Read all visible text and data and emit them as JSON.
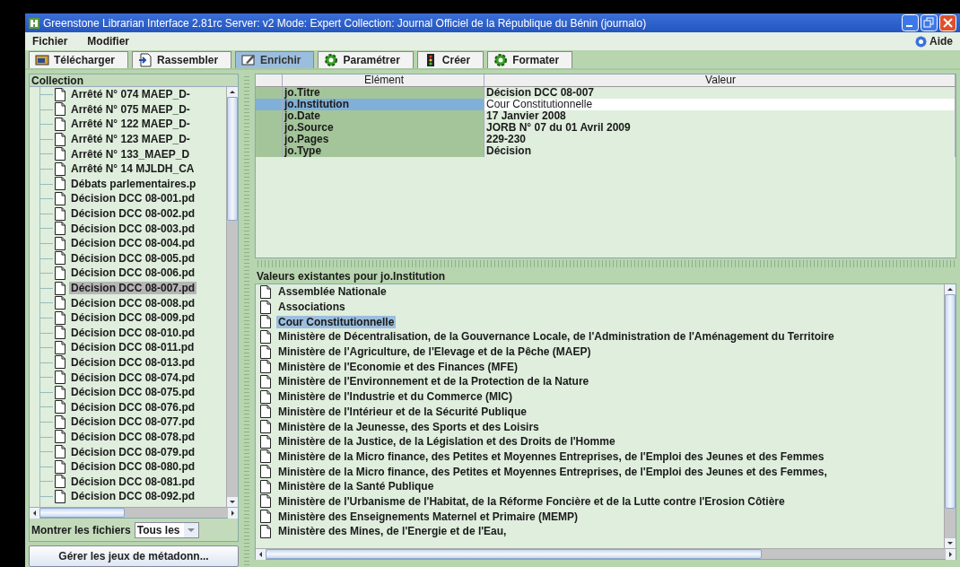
{
  "window": {
    "title": "Greenstone Librarian Interface 2.81rc  Server: v2  Mode: Expert  Collection: Journal Officiel de la République du Bénin (journalo)"
  },
  "menu": {
    "items": [
      "Fichier",
      "Modifier"
    ],
    "help": "Aide"
  },
  "tabs": [
    {
      "label": "Télécharger",
      "selected": false
    },
    {
      "label": "Rassembler",
      "selected": false
    },
    {
      "label": "Enrichir",
      "selected": true
    },
    {
      "label": "Paramétrer",
      "selected": false
    },
    {
      "label": "Créer",
      "selected": false
    },
    {
      "label": "Formater",
      "selected": false
    }
  ],
  "collection": {
    "title": "Collection",
    "items": [
      {
        "label": "Arrêté N° 074 MAEP_D-",
        "selected": false
      },
      {
        "label": "Arrêté N° 075 MAEP_D-",
        "selected": false
      },
      {
        "label": "Arrêté N° 122 MAEP_D-",
        "selected": false
      },
      {
        "label": "Arrêté N° 123 MAEP_D-",
        "selected": false
      },
      {
        "label": "Arrêté N° 133_MAEP_D",
        "selected": false
      },
      {
        "label": "Arrêté N° 14 MJLDH_CA",
        "selected": false
      },
      {
        "label": "Débats parlementaires.p",
        "selected": false
      },
      {
        "label": "Décision DCC 08-001.pd",
        "selected": false
      },
      {
        "label": "Décision DCC 08-002.pd",
        "selected": false
      },
      {
        "label": "Décision DCC 08-003.pd",
        "selected": false
      },
      {
        "label": "Décision DCC 08-004.pd",
        "selected": false
      },
      {
        "label": "Décision DCC 08-005.pd",
        "selected": false
      },
      {
        "label": "Décision DCC 08-006.pd",
        "selected": false
      },
      {
        "label": "Décision DCC 08-007.pd",
        "selected": true
      },
      {
        "label": "Décision DCC 08-008.pd",
        "selected": false
      },
      {
        "label": "Décision DCC 08-009.pd",
        "selected": false
      },
      {
        "label": "Décision DCC 08-010.pd",
        "selected": false
      },
      {
        "label": "Décision DCC 08-011.pd",
        "selected": false
      },
      {
        "label": "Décision DCC 08-013.pd",
        "selected": false
      },
      {
        "label": "Décision DCC 08-074.pd",
        "selected": false
      },
      {
        "label": "Décision DCC 08-075.pd",
        "selected": false
      },
      {
        "label": "Décision DCC 08-076.pd",
        "selected": false
      },
      {
        "label": "Décision DCC 08-077.pd",
        "selected": false
      },
      {
        "label": "Décision DCC 08-078.pd",
        "selected": false
      },
      {
        "label": "Décision DCC 08-079.pd",
        "selected": false
      },
      {
        "label": "Décision DCC 08-080.pd",
        "selected": false
      },
      {
        "label": "Décision DCC 08-081.pd",
        "selected": false
      },
      {
        "label": "Décision DCC 08-092.pd",
        "selected": false
      }
    ],
    "filter_label": "Montrer les fichiers",
    "filter_value": "Tous les",
    "manage_button": "Gérer les jeux de métadonn..."
  },
  "metadata": {
    "columns": [
      "Elément",
      "Valeur"
    ],
    "rows": [
      {
        "element": "jo.Titre",
        "value": "Décision DCC 08-007",
        "selected": false
      },
      {
        "element": "jo.Institution",
        "value": "Cour Constitutionnelle",
        "selected": true
      },
      {
        "element": "jo.Date",
        "value": "17 Janvier 2008",
        "selected": false
      },
      {
        "element": "jo.Source",
        "value": "JORB N° 07 du 01 Avril 2009",
        "selected": false
      },
      {
        "element": "jo.Pages",
        "value": "229-230",
        "selected": false
      },
      {
        "element": "jo.Type",
        "value": "Décision",
        "selected": false
      }
    ]
  },
  "existing_values": {
    "title": "Valeurs existantes pour jo.Institution",
    "items": [
      {
        "label": "Assemblée Nationale",
        "selected": false
      },
      {
        "label": "Associations",
        "selected": false
      },
      {
        "label": "Cour Constitutionnelle",
        "selected": true
      },
      {
        "label": "Ministère de Décentralisation, de la Gouvernance Locale, de l'Administration de l'Aménagement du Territoire",
        "selected": false
      },
      {
        "label": "Ministère de l'Agriculture, de l'Elevage et de la Pêche (MAEP)",
        "selected": false
      },
      {
        "label": "Ministère de l'Economie et des Finances (MFE)",
        "selected": false
      },
      {
        "label": "Ministère de l'Environnement et de la Protection de la Nature",
        "selected": false
      },
      {
        "label": "Ministère de l'Industrie et du Commerce (MIC)",
        "selected": false
      },
      {
        "label": "Ministère de l'Intérieur et de la Sécurité Publique",
        "selected": false
      },
      {
        "label": "Ministère de la Jeunesse, des Sports et des Loisirs",
        "selected": false
      },
      {
        "label": "Ministère de la Justice, de la Législation et des Droits de l'Homme",
        "selected": false
      },
      {
        "label": "Ministère de la Micro finance, des Petites et Moyennes Entreprises, de l'Emploi des Jeunes et des Femmes",
        "selected": false
      },
      {
        "label": "Ministère de la Micro finance, des Petites et Moyennes Entreprises, de l'Emploi des Jeunes et des Femmes,",
        "selected": false
      },
      {
        "label": "Ministère de la Santé Publique",
        "selected": false
      },
      {
        "label": "Ministère de l'Urbanisme de l'Habitat, de la Réforme Foncière et de la Lutte contre l'Erosion Côtière",
        "selected": false
      },
      {
        "label": "Ministère des Enseignements Maternel et Primaire (MEMP)",
        "selected": false
      },
      {
        "label": "Ministère des Mines, de l'Energie et de l'Eau,",
        "selected": false
      }
    ]
  }
}
